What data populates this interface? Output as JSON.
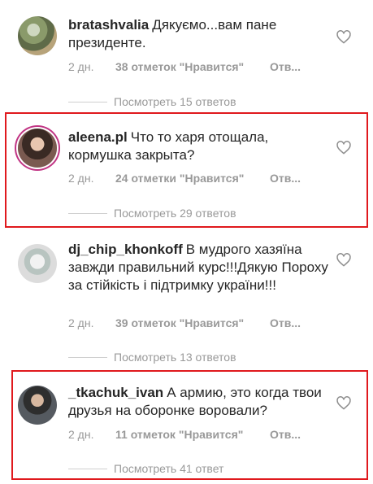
{
  "comments": [
    {
      "username": "bratashvalia",
      "text": "Дякуємо...вам пане президенте.",
      "time": "2 дн.",
      "likes": "38 отметок \"Нравится\"",
      "reply": "Отв...",
      "view_replies": "Посмотреть 15 ответов"
    },
    {
      "username": "aleena.pl",
      "text": "Что то харя отощала, кормушка закрыта?",
      "time": "2 дн.",
      "likes": "24 отметки \"Нравится\"",
      "reply": "Отв...",
      "view_replies": "Посмотреть 29 ответов"
    },
    {
      "username": "dj_chip_khonkoff",
      "text": "В мудрого хазяїна завжди правильний курс!!!Дякую Пороху за стійкість і підтримку україни!!!",
      "time": "2 дн.",
      "likes": "39 отметок \"Нравится\"",
      "reply": "Отв...",
      "view_replies": "Посмотреть 13 ответов"
    },
    {
      "username": "_tkachuk_ivan",
      "text": "А армию, это когда твои друзья на оборонке воровали?",
      "time": "2 дн.",
      "likes": "11 отметок \"Нравится\"",
      "reply": "Отв...",
      "view_replies": "Посмотреть 41 ответ"
    }
  ],
  "colors": {
    "highlight": "#e0191d",
    "muted": "#999999",
    "text": "#262626"
  },
  "icons": {
    "like": "heart-outline-icon"
  }
}
